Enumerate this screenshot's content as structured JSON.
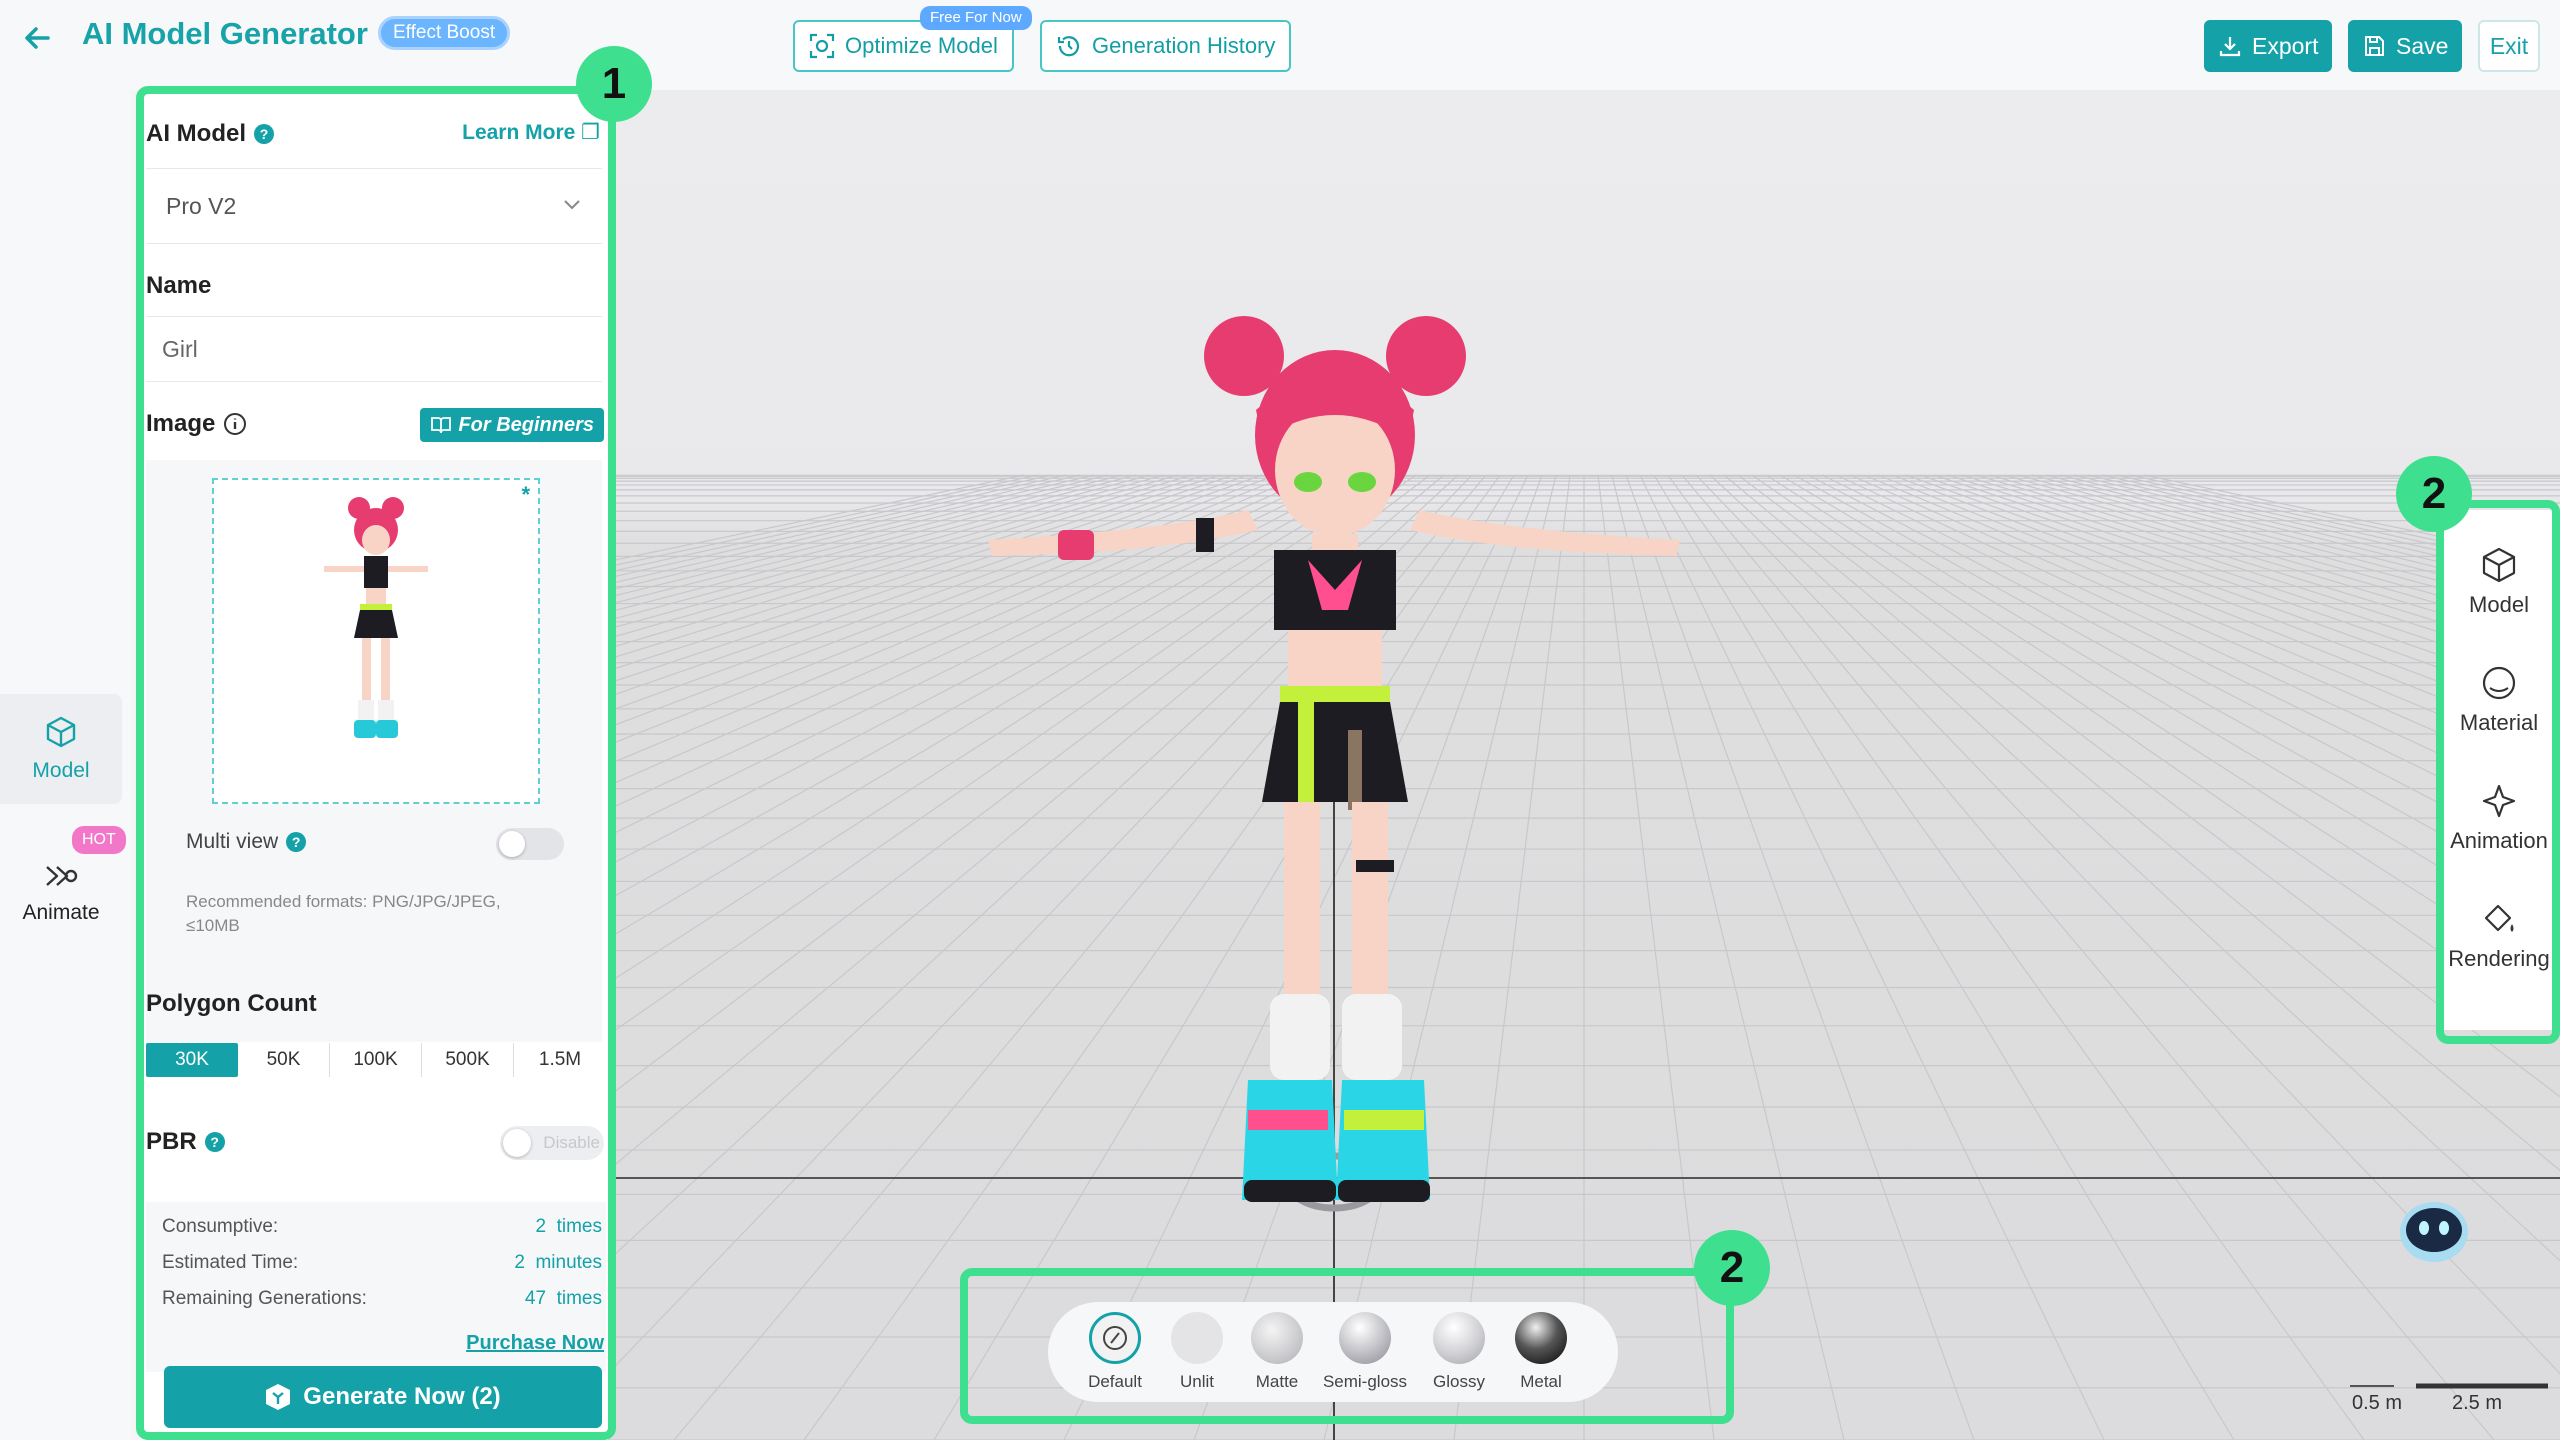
{
  "header": {
    "title": "AI Model Generator",
    "effect_badge": "Effect Boost",
    "optimize_label": "Optimize Model",
    "free_badge": "Free For Now",
    "history_label": "Generation History",
    "export_label": "Export",
    "save_label": "Save",
    "exit_label": "Exit"
  },
  "rail": {
    "model_label": "Model",
    "animate_label": "Animate",
    "hot_badge": "HOT"
  },
  "panel": {
    "ai_model_label": "AI Model",
    "learn_more": "Learn More",
    "model_value": "Pro V2",
    "name_label": "Name",
    "name_value": "Girl",
    "image_label": "Image",
    "beginners_label": "For Beginners",
    "multi_view_label": "Multi view",
    "multi_view_on": false,
    "formats_note": "Recommended formats: PNG/JPG/JPEG, ≤10MB",
    "polygon_label": "Polygon Count",
    "polygon_options": [
      "30K",
      "50K",
      "100K",
      "500K",
      "1.5M"
    ],
    "polygon_selected": "30K",
    "pbr_label": "PBR",
    "pbr_state": "Disable",
    "stats": {
      "consumptive_label": "Consumptive:",
      "consumptive_value": "2",
      "consumptive_unit": "times",
      "time_label": "Estimated Time:",
      "time_value": "2",
      "time_unit": "minutes",
      "remaining_label": "Remaining Generations:",
      "remaining_value": "47",
      "remaining_unit": "times"
    },
    "purchase_label": "Purchase Now",
    "generate_label": "Generate Now (2)"
  },
  "annotations": {
    "panel_badge": "1",
    "toolbar_badge": "2",
    "materials_badge": "2"
  },
  "right_toolbar": {
    "items": [
      "Model",
      "Material",
      "Animation",
      "Rendering"
    ]
  },
  "materials": {
    "items": [
      "Default",
      "Unlit",
      "Matte",
      "Semi-gloss",
      "Glossy",
      "Metal"
    ]
  },
  "scale": {
    "small": "0.5 m",
    "large": "2.5 m"
  },
  "colors": {
    "accent": "#14a2a8",
    "annotation": "#3ee08f",
    "hot": "#f277c8",
    "badge_blue": "#6bb5ff"
  }
}
